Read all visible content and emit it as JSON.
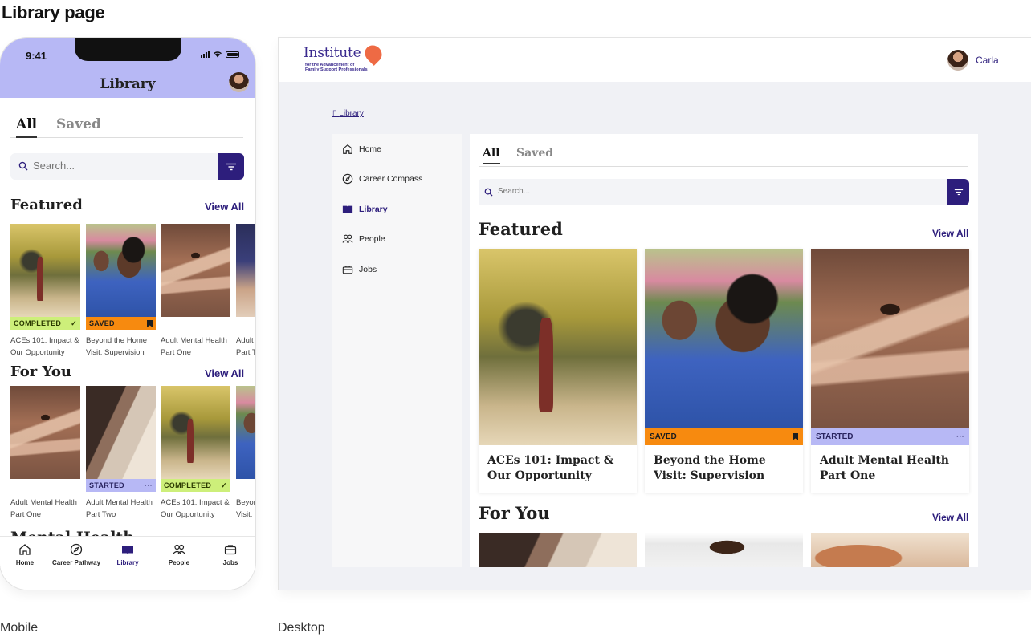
{
  "page": {
    "title": "Library page",
    "captions": {
      "mobile": "Mobile",
      "desktop": "Desktop"
    }
  },
  "colors": {
    "brand": "#2d1e7c",
    "header": "#b7b8f5",
    "completed": "#cdef7a",
    "saved": "#f78a0f",
    "started": "#b7b8f5"
  },
  "mobile": {
    "status": {
      "time": "9:41",
      "icons": [
        "signal-icon",
        "wifi-icon",
        "battery-icon"
      ]
    },
    "header": {
      "title": "Library"
    },
    "tabs": [
      {
        "label": "All",
        "active": true
      },
      {
        "label": "Saved",
        "active": false
      }
    ],
    "search": {
      "placeholder": "Search..."
    },
    "featured": {
      "title": "Featured",
      "view_all": "View All",
      "cards": [
        {
          "badge": "COMPLETED",
          "badge_icon": "check-icon",
          "title": "ACEs 101: Impact & Our Opportunity"
        },
        {
          "badge": "SAVED",
          "badge_icon": "bookmark-icon",
          "title": "Beyond the Home Visit: Supervision"
        },
        {
          "badge": "",
          "title": "Adult Mental Health Part One"
        },
        {
          "badge": "",
          "title": "Adult Mental Health Part Two"
        }
      ]
    },
    "for_you": {
      "title": "For You",
      "view_all": "View All",
      "cards": [
        {
          "badge": "",
          "title": "Adult Mental Health Part One"
        },
        {
          "badge": "STARTED",
          "badge_icon": "more-icon",
          "title": "Adult Mental Health Part Two"
        },
        {
          "badge": "COMPLETED",
          "badge_icon": "check-icon",
          "title": "ACEs 101: Impact & Our Opportunity"
        },
        {
          "badge": "",
          "title": "Beyond the Home Visit: Supervision"
        }
      ]
    },
    "next_section": "Mental Health",
    "nav": [
      {
        "label": "Home",
        "icon": "home-icon",
        "active": false
      },
      {
        "label": "Career Pathway",
        "icon": "compass-icon",
        "active": false
      },
      {
        "label": "Library",
        "icon": "book-icon",
        "active": true
      },
      {
        "label": "People",
        "icon": "people-icon",
        "active": false
      },
      {
        "label": "Jobs",
        "icon": "briefcase-icon",
        "active": false
      }
    ]
  },
  "desktop": {
    "logo": {
      "word": "Institute",
      "sub_line1": "for the Advancement of",
      "sub_line2": "Family Support Professionals"
    },
    "user": {
      "name": "Carla"
    },
    "breadcrumb": "Library",
    "sidebar": [
      {
        "label": "Home",
        "icon": "home-icon",
        "active": false
      },
      {
        "label": "Career Compass",
        "icon": "compass-icon",
        "active": false
      },
      {
        "label": "Library",
        "icon": "book-icon",
        "active": true
      },
      {
        "label": "People",
        "icon": "people-icon",
        "active": false
      },
      {
        "label": "Jobs",
        "icon": "briefcase-icon",
        "active": false
      }
    ],
    "tabs": [
      {
        "label": "All",
        "active": true
      },
      {
        "label": "Saved",
        "active": false
      }
    ],
    "search": {
      "placeholder": "Search..."
    },
    "featured": {
      "title": "Featured",
      "view_all": "View All",
      "cards": [
        {
          "badge": "",
          "title": "ACEs 101: Impact & Our Opportunity"
        },
        {
          "badge": "SAVED",
          "badge_icon": "bookmark-icon",
          "title": "Beyond the Home Visit: Supervision"
        },
        {
          "badge": "STARTED",
          "badge_icon": "more-icon",
          "title": "Adult Mental Health Part One"
        }
      ]
    },
    "for_you": {
      "title": "For You",
      "view_all": "View All"
    }
  }
}
